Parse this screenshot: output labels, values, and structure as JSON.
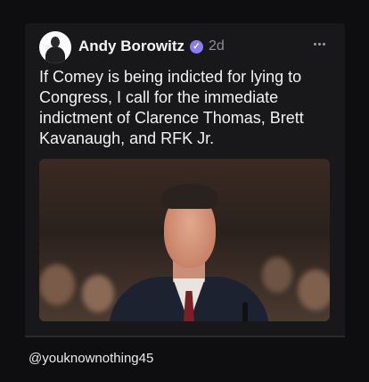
{
  "post": {
    "author": "Andy Borowitz",
    "time_ago": "2d",
    "text": "If Comey is being indicted for lying to Congress, I call for the immediate indictment of Clarence Thomas, Brett Kavanaugh, and RFK Jr.",
    "verified_icon": "verified-check-icon",
    "more_icon": "more-options-icon"
  },
  "watermark": "@youknownothing45",
  "colors": {
    "background": "#0e0e10",
    "card": "#18181b",
    "verified": "#8b7cf0",
    "muted": "#8e8e93"
  }
}
